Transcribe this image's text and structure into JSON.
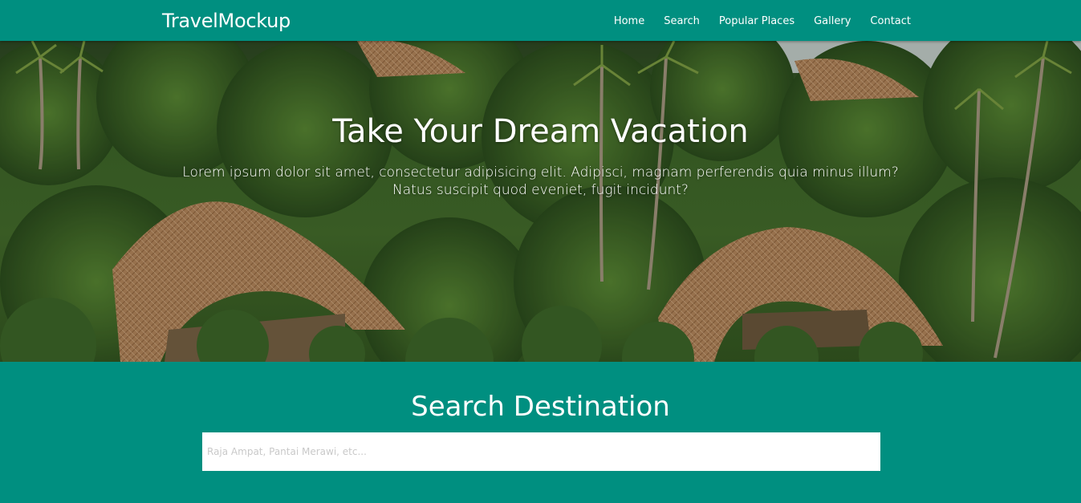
{
  "navbar": {
    "brand": "TravelMockup",
    "links": [
      "Home",
      "Search",
      "Popular Places",
      "Gallery",
      "Contact"
    ]
  },
  "hero": {
    "title": "Take Your Dream Vacation",
    "text": "Lorem ipsum dolor sit amet, consectetur adipisicing elit. Adipisci, magnam perferendis quia minus illum? Natus suscipit quod eveniet, fugit incidunt?"
  },
  "search": {
    "title": "Search Destination",
    "placeholder": "Raja Ampat, Pantai Merawi, etc..."
  },
  "colors": {
    "primary": "#008f80",
    "input_background": "#ffffff"
  }
}
